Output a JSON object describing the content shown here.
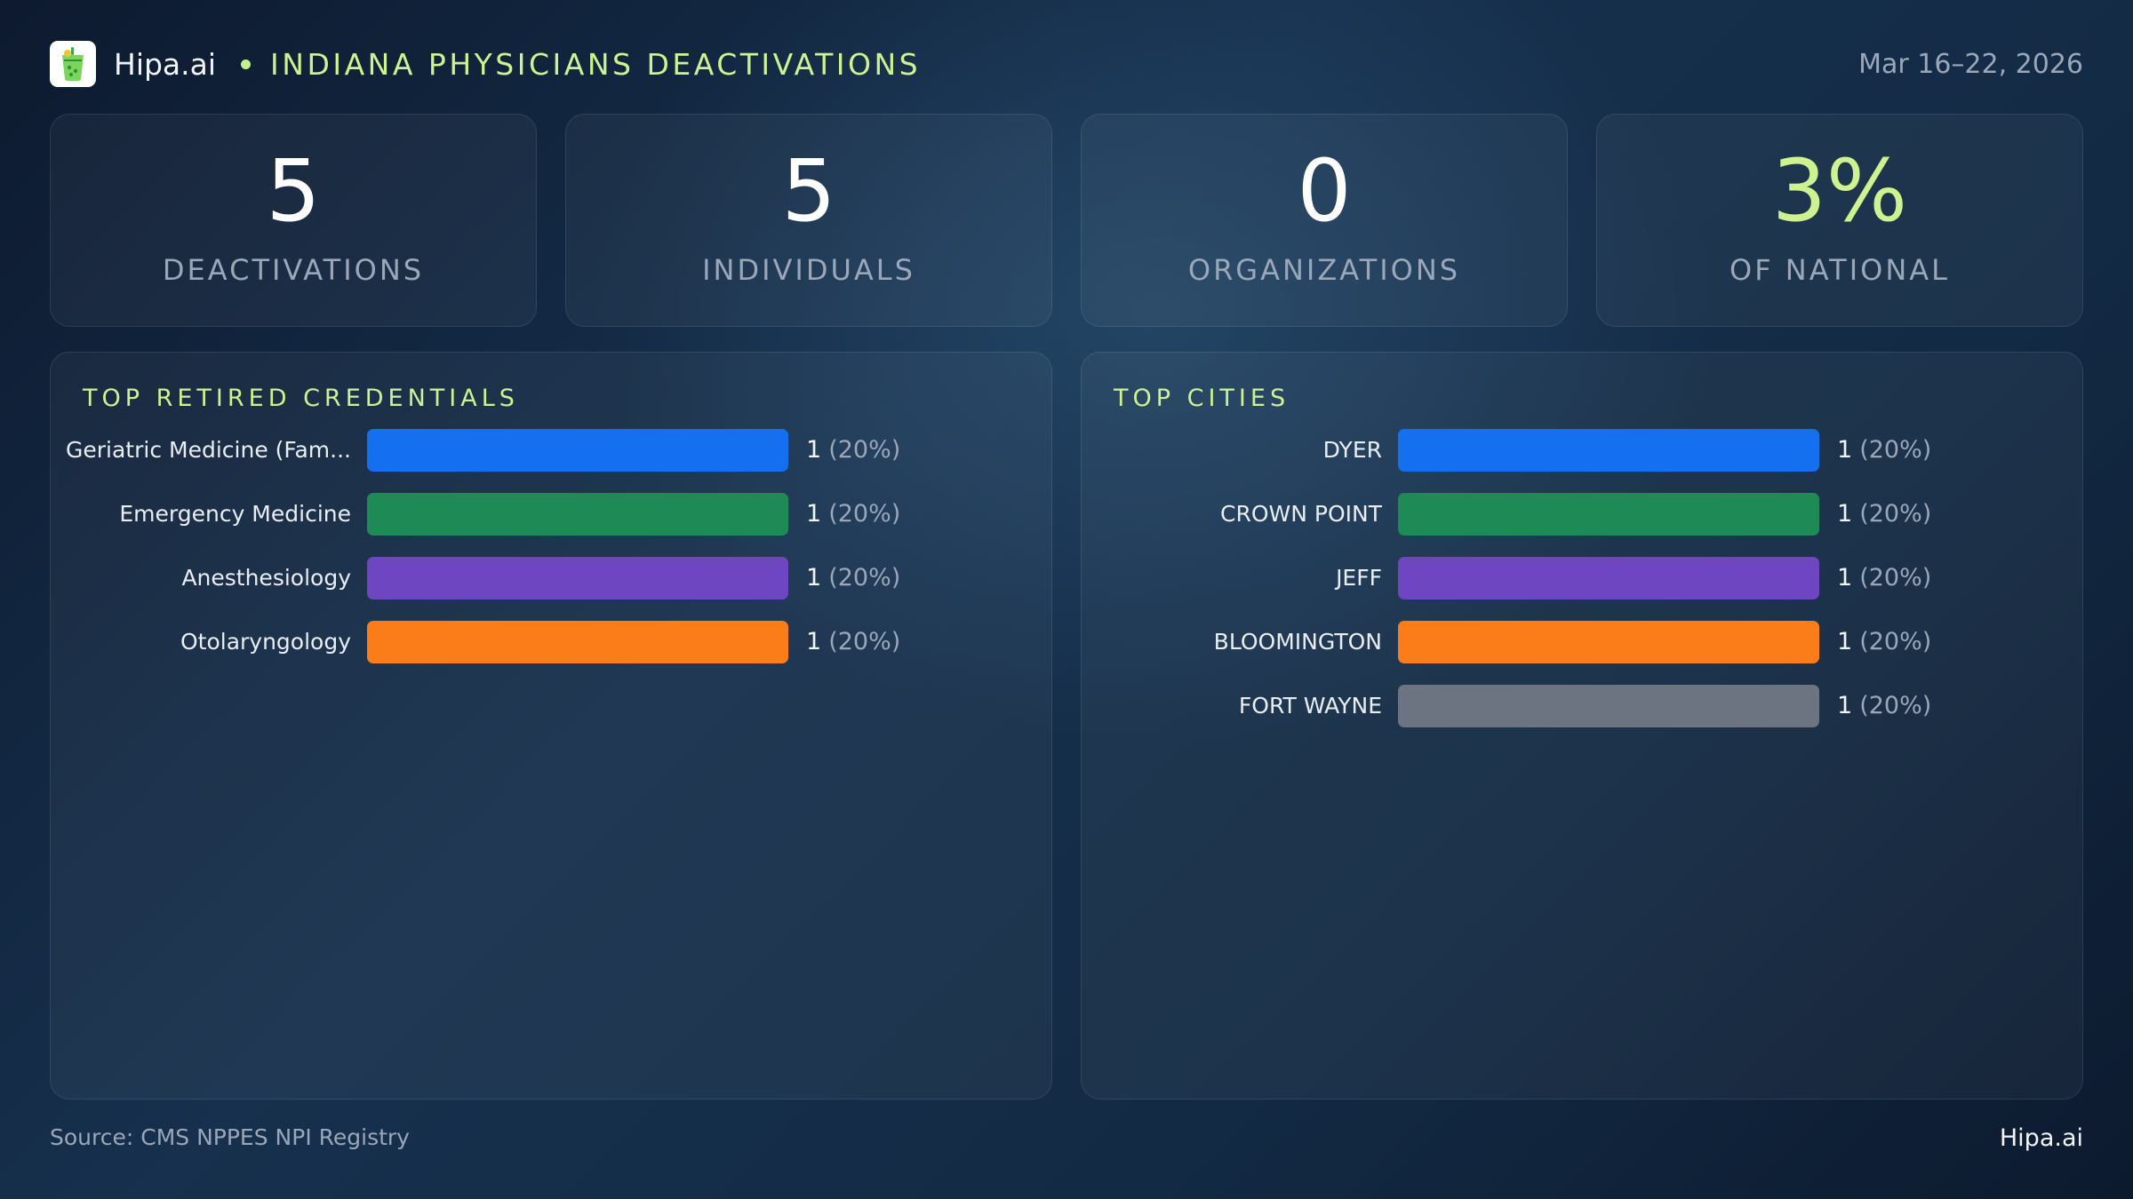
{
  "header": {
    "brand": "Hipa.ai",
    "report_title": "INDIANA PHYSICIANS DEACTIVATIONS",
    "date_range": "Mar 16–22, 2026",
    "logo_icon": "drink-cup-icon"
  },
  "kpis": [
    {
      "value": "5",
      "label": "DEACTIVATIONS",
      "accent": false
    },
    {
      "value": "5",
      "label": "INDIVIDUALS",
      "accent": false
    },
    {
      "value": "0",
      "label": "ORGANIZATIONS",
      "accent": false
    },
    {
      "value": "3%",
      "label": "OF NATIONAL",
      "accent": true
    }
  ],
  "colors": {
    "accent": "#cdf28f",
    "blue": "#1570ef",
    "green": "#1e8a55",
    "purple": "#6e46c2",
    "orange": "#fb7d19",
    "gray": "#6b7480"
  },
  "chart_data": [
    {
      "type": "bar",
      "orientation": "horizontal",
      "title": "TOP RETIRED CREDENTIALS",
      "categories": [
        "Geriatric Medicine (Fam...",
        "Emergency Medicine",
        "Anesthesiology",
        "Otolaryngology"
      ],
      "values": [
        1,
        1,
        1,
        1
      ],
      "percent_labels": [
        "(20%)",
        "(20%)",
        "(20%)",
        "(20%)"
      ],
      "colors": [
        "#1570ef",
        "#1e8a55",
        "#6e46c2",
        "#fb7d19"
      ],
      "xlim": [
        0,
        1
      ],
      "grid": false
    },
    {
      "type": "bar",
      "orientation": "horizontal",
      "title": "TOP CITIES",
      "categories": [
        "DYER",
        "CROWN POINT",
        "JEFF",
        "BLOOMINGTON",
        "FORT WAYNE"
      ],
      "values": [
        1,
        1,
        1,
        1,
        1
      ],
      "percent_labels": [
        "(20%)",
        "(20%)",
        "(20%)",
        "(20%)",
        "(20%)"
      ],
      "colors": [
        "#1570ef",
        "#1e8a55",
        "#6e46c2",
        "#fb7d19",
        "#6b7480"
      ],
      "xlim": [
        0,
        1
      ],
      "grid": false
    }
  ],
  "footer": {
    "source": "Source: CMS NPPES NPI Registry",
    "brand": "Hipa.ai"
  }
}
